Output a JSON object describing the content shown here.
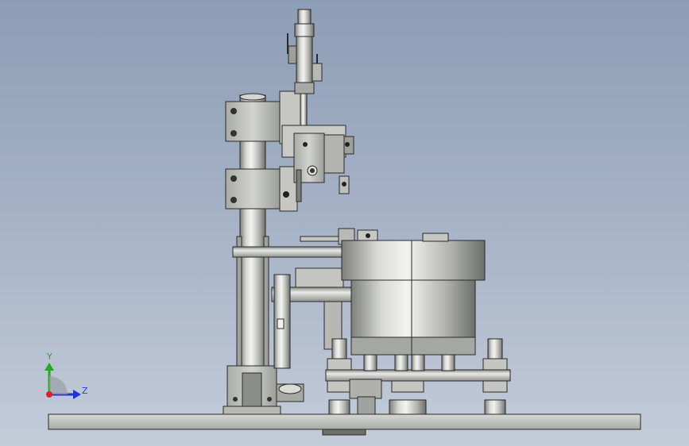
{
  "triad": {
    "x_label": "",
    "y_label": "Y",
    "z_label": "Z",
    "y_color": "#22aa22",
    "z_color": "#2233dd",
    "x_color": "#dd2222"
  },
  "colors": {
    "background_top": "#8d9db6",
    "background_bottom": "#c3ccd9",
    "metal_light": "#e4e5e1",
    "metal_mid": "#b7b8b3",
    "metal_dark": "#6f716c",
    "edge": "#2a2a2a"
  }
}
